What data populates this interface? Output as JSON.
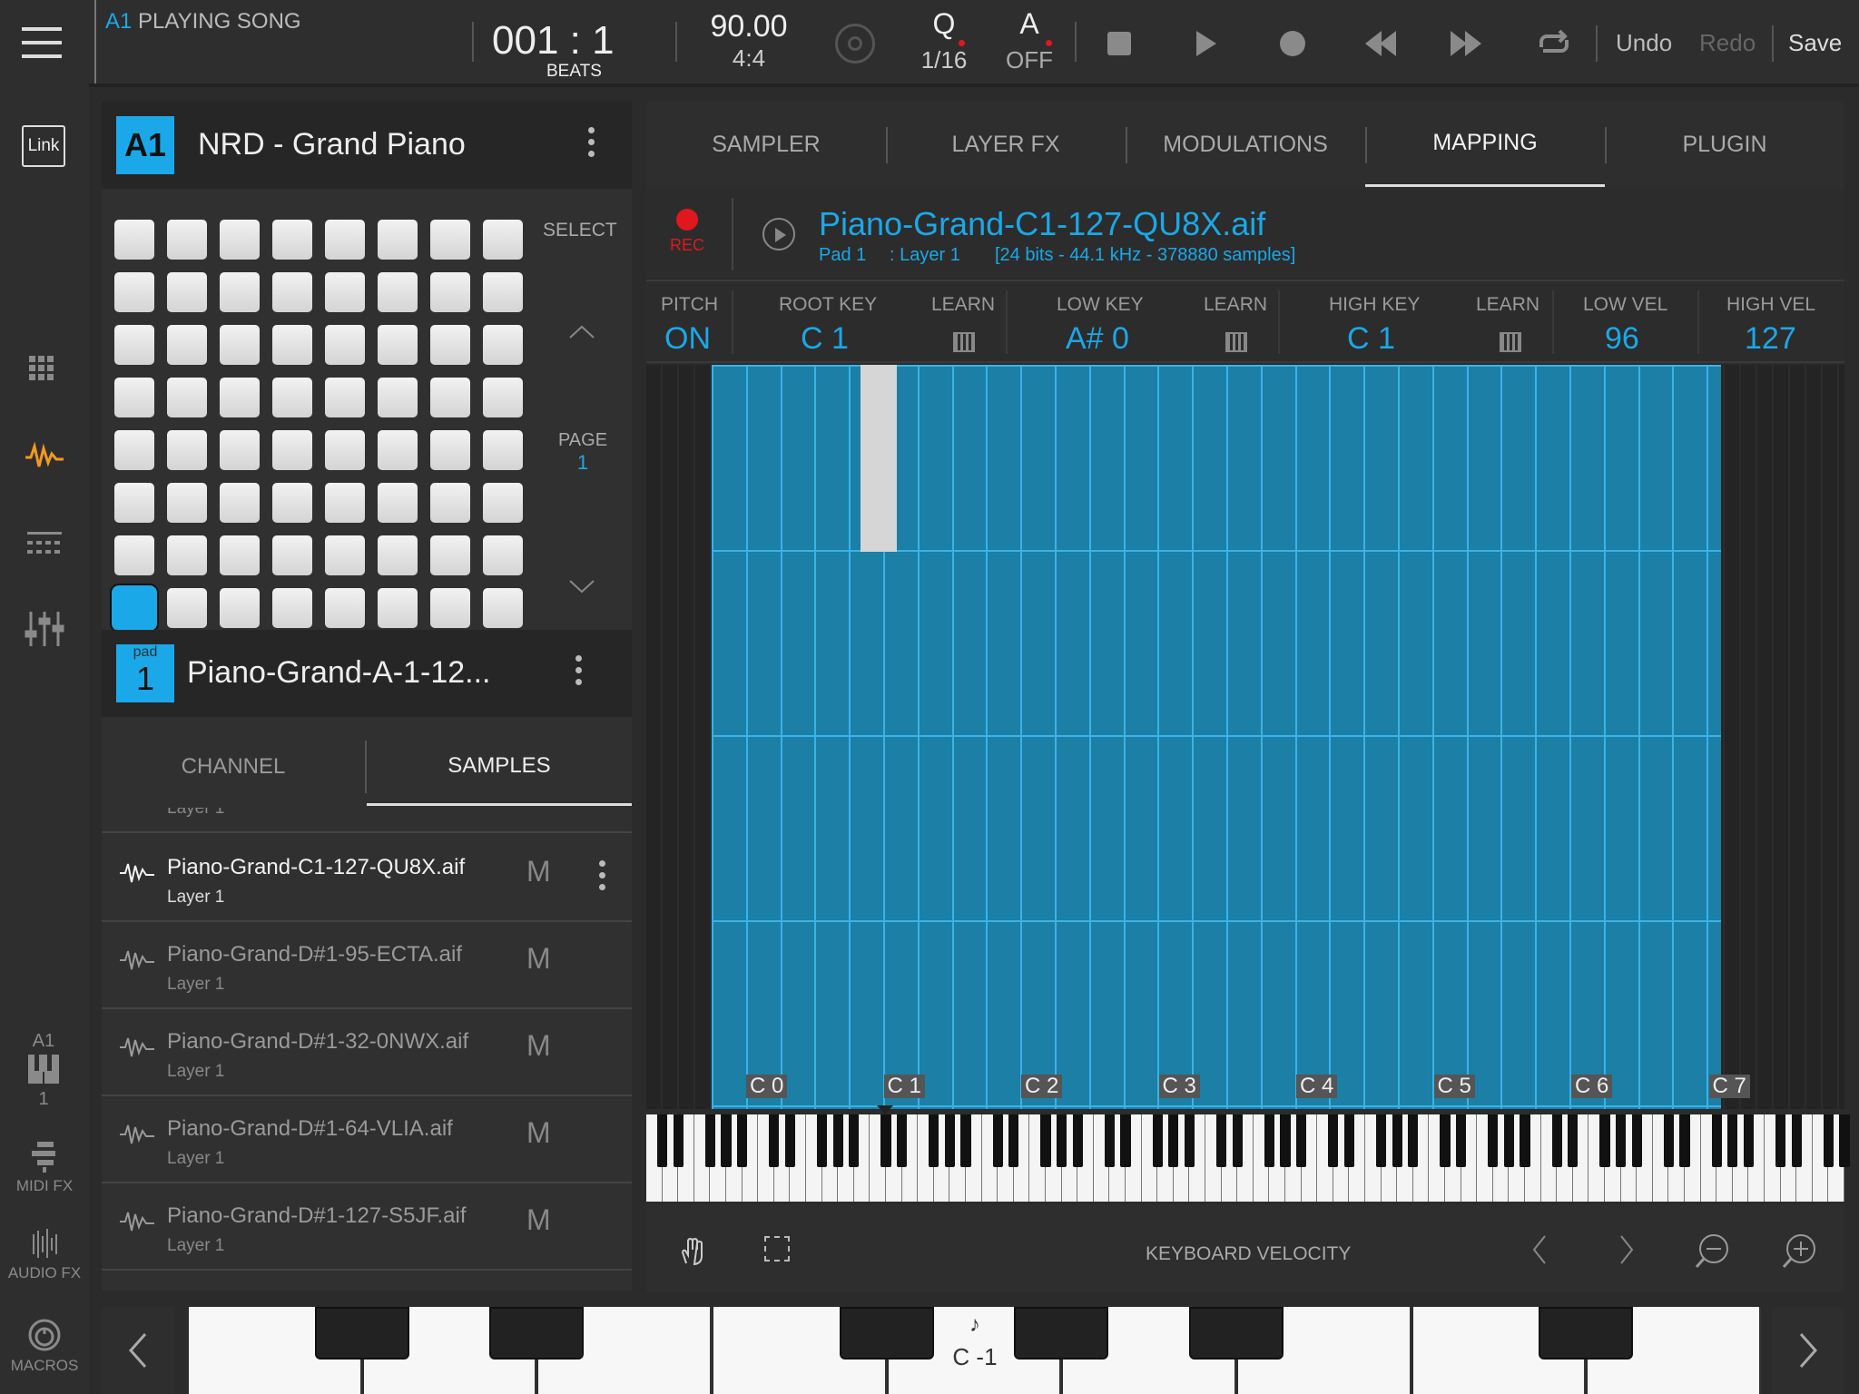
{
  "topbar": {
    "track_id": "A1",
    "song_status": "PLAYING SONG",
    "position": "001 : 1",
    "position_unit": "BEATS",
    "tempo": "90.00",
    "time_signature": "4:4",
    "quantize_label": "Q",
    "quantize_value": "1/16",
    "auto_label": "A",
    "auto_value": "OFF",
    "undo": "Undo",
    "redo": "Redo",
    "save": "Save"
  },
  "leftnav": {
    "link_label": "Link",
    "track_label": "A1",
    "track_number": "1",
    "midi_fx": "MIDI FX",
    "audio_fx": "AUDIO FX",
    "macros": "MACROS"
  },
  "instrument": {
    "slot": "A1",
    "name": "NRD - Grand Piano"
  },
  "pad_grid": {
    "select_label": "SELECT",
    "page_label": "PAGE",
    "page_number": "1",
    "selected_pad": 57
  },
  "pad": {
    "tag": "pad",
    "number": "1",
    "name": "Piano-Grand-A-1-12..."
  },
  "panel_tabs": {
    "channel": "CHANNEL",
    "samples": "SAMPLES"
  },
  "samples": [
    {
      "name": "Piano-Grand-C1-127-QU8X.aif",
      "layer": "Layer 1",
      "mute": "M",
      "active": true
    },
    {
      "name": "Piano-Grand-D#1-95-ECTA.aif",
      "layer": "Layer 1",
      "mute": "M",
      "active": false
    },
    {
      "name": "Piano-Grand-D#1-32-0NWX.aif",
      "layer": "Layer 1",
      "mute": "M",
      "active": false
    },
    {
      "name": "Piano-Grand-D#1-64-VLIA.aif",
      "layer": "Layer 1",
      "mute": "M",
      "active": false
    },
    {
      "name": "Piano-Grand-D#1-127-S5JF.aif",
      "layer": "Layer 1",
      "mute": "M",
      "active": false
    }
  ],
  "samples_partial_top": "Layer 1",
  "editor_tabs": [
    "SAMPLER",
    "LAYER FX",
    "MODULATIONS",
    "MAPPING",
    "PLUGIN"
  ],
  "active_editor_tab": "MAPPING",
  "sample_header": {
    "rec": "REC",
    "file": "Piano-Grand-C1-127-QU8X.aif",
    "pad": "Pad 1",
    "layer": ": Layer 1",
    "info": "[24 bits - 44.1 kHz - 378880 samples]"
  },
  "mapping": {
    "pitch_label": "PITCH",
    "pitch": "ON",
    "root_label": "ROOT KEY",
    "root": "C 1",
    "learn1": "LEARN",
    "low_label": "LOW KEY",
    "low": "A# 0",
    "learn2": "LEARN",
    "high_label": "HIGH KEY",
    "high": "C 1",
    "learn3": "LEARN",
    "lowvel_label": "LOW VEL",
    "lowvel": "96",
    "highvel_label": "HIGH VEL",
    "highvel": "127"
  },
  "octaves": [
    "C 0",
    "C 1",
    "C 2",
    "C 3",
    "C 4",
    "C 5",
    "C 6",
    "C 7"
  ],
  "bottom_toolbar": {
    "velocity_label": "KEYBOARD VELOCITY"
  },
  "play_keyboard": {
    "note_symbol": "♪",
    "note": "C -1"
  },
  "colors": {
    "accent": "#1aa8e8",
    "rec": "#e0171d",
    "waveform_icon": "#f29a1e",
    "grid": "#1c7fa6"
  }
}
